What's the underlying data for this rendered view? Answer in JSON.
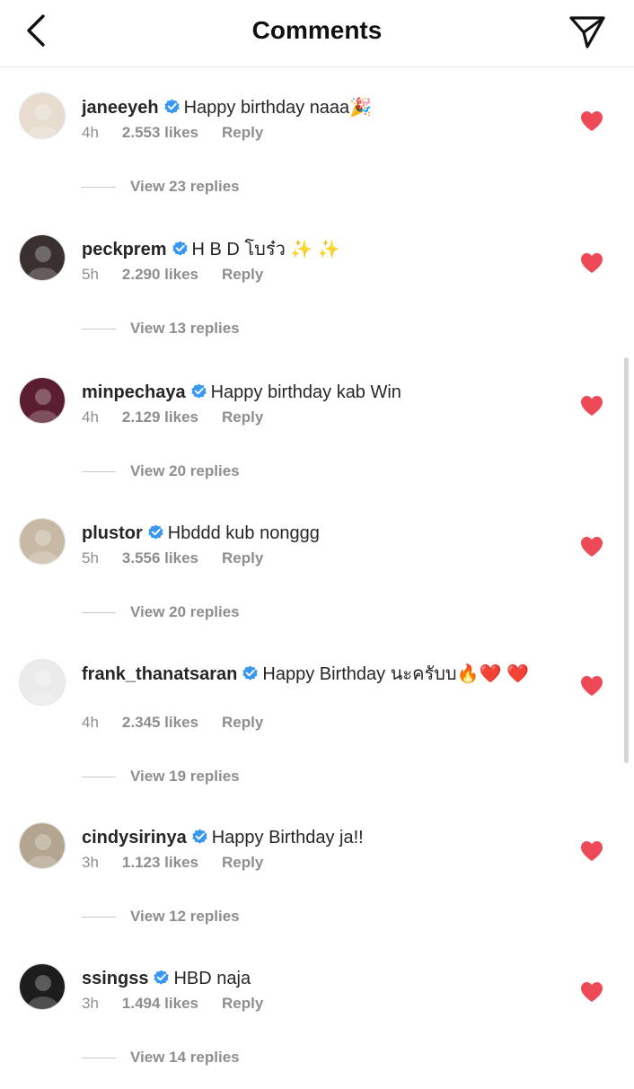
{
  "header": {
    "title": "Comments"
  },
  "comments": [
    {
      "username": "janeeyeh",
      "text": "Happy birthday naaa🎉",
      "time": "4h",
      "likes": "2.553 likes",
      "reply": "Reply",
      "view_replies": "View 23 replies",
      "avatar_color": "#e7dccd"
    },
    {
      "username": "peckprem",
      "text": "H B D โบร๋ว ✨ ✨",
      "time": "5h",
      "likes": "2.290 likes",
      "reply": "Reply",
      "view_replies": "View 13 replies",
      "avatar_color": "#3a3030"
    },
    {
      "username": "minpechaya",
      "text": "Happy birthday kab Win",
      "time": "4h",
      "likes": "2.129 likes",
      "reply": "Reply",
      "view_replies": "View 20 replies",
      "avatar_color": "#5a1e30"
    },
    {
      "username": "plustor",
      "text": "Hbddd kub nonggg",
      "time": "5h",
      "likes": "3.556 likes",
      "reply": "Reply",
      "view_replies": "View 20 replies",
      "avatar_color": "#c8b9a6"
    },
    {
      "username": "frank_thanatsaran",
      "text": "Happy Birthday นะครับบ🔥❤️ ❤️",
      "time": "4h",
      "likes": "2.345 likes",
      "reply": "Reply",
      "view_replies": "View 19 replies",
      "avatar_color": "#ebebeb"
    },
    {
      "username": "cindysirinya",
      "text": "Happy Birthday ja!!",
      "time": "3h",
      "likes": "1.123 likes",
      "reply": "Reply",
      "view_replies": "View 12 replies",
      "avatar_color": "#b3a58f"
    },
    {
      "username": "ssingss",
      "text": "HBD naja",
      "time": "3h",
      "likes": "1.494 likes",
      "reply": "Reply",
      "view_replies": "View 14 replies",
      "avatar_color": "#1d1d1d"
    }
  ],
  "colors": {
    "verified": "#3897f0",
    "like": "#ed4956",
    "muted": "#8e8e8e"
  },
  "icons": {
    "back": "chevron-left-icon",
    "send": "paper-plane-icon",
    "like": "heart-icon",
    "verified": "verified-badge-icon"
  }
}
